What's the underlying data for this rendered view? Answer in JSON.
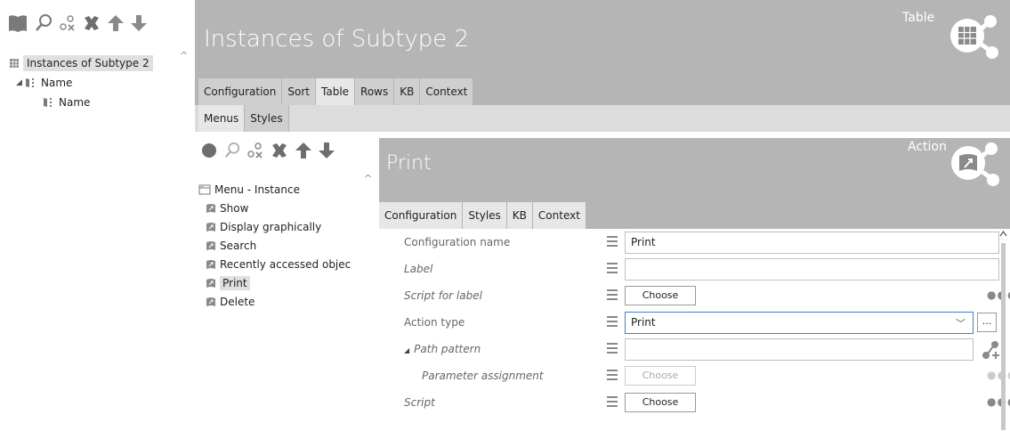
{
  "left": {
    "toolbar_icons": [
      "book-icon",
      "search-icon",
      "link-icon",
      "delete-icon",
      "up-arrow-icon",
      "down-arrow-icon"
    ],
    "tree": [
      {
        "label": "Instances of Subtype 2",
        "level": 0,
        "selected": true
      },
      {
        "label": "Name",
        "level": 1
      },
      {
        "label": "Name",
        "level": 2
      }
    ]
  },
  "main": {
    "title": "Instances of Subtype 2",
    "corner_label": "Table",
    "tabs": [
      "Configuration",
      "Sort",
      "Table",
      "Rows",
      "KB",
      "Context"
    ],
    "active_tab": "Table",
    "subtabs": [
      "Menus",
      "Styles"
    ],
    "active_subtab": "Menus"
  },
  "menu": {
    "toolbar_icons": [
      "circle-icon",
      "search-icon",
      "link-icon",
      "delete-icon",
      "up-arrow-icon",
      "down-arrow-icon"
    ],
    "root": "Menu - Instance",
    "items": [
      "Show",
      "Display graphically",
      "Search",
      "Recently accessed objec",
      "Print",
      "Delete"
    ],
    "selected": "Print"
  },
  "action": {
    "title": "Print",
    "corner_label": "Action",
    "tabs": [
      "Configuration",
      "Styles",
      "KB",
      "Context"
    ],
    "active_tab": "Configuration",
    "fields": {
      "config_name_label": "Configuration name",
      "config_name_value": "Print",
      "label_label": "Label",
      "label_value": "",
      "script_for_label_label": "Script for label",
      "script_for_label_button": "Choose",
      "action_type_label": "Action type",
      "action_type_value": "Print",
      "action_type_more": "...",
      "path_pattern_label": "Path pattern",
      "path_pattern_value": "",
      "parameter_assignment_label": "Parameter assignment",
      "parameter_assignment_button": "Choose",
      "script_label": "Script",
      "script_button": "Choose"
    }
  },
  "colors": {
    "header_grey": "#b5b5b5",
    "tab_inactive": "#cfcfcf",
    "tab_active": "#e7e7e7",
    "focus_border": "#3c7fd4"
  }
}
